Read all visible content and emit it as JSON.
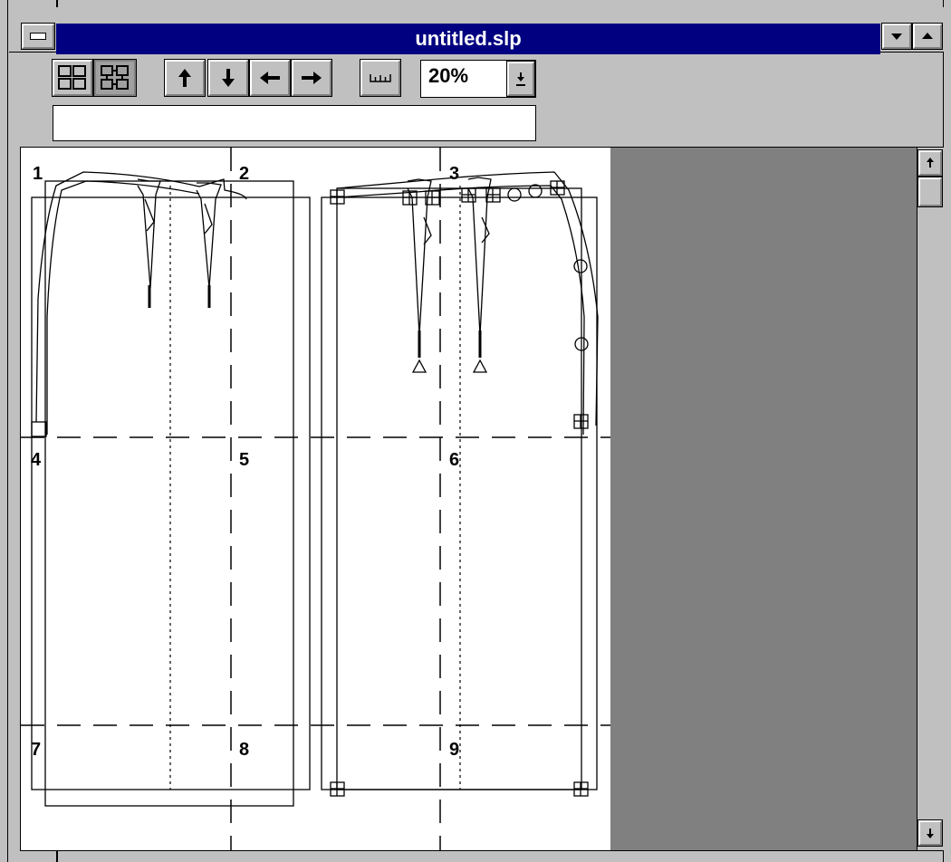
{
  "window": {
    "title": "untitled.slp"
  },
  "toolbar": {
    "zoom_value": "20%",
    "status_text": ""
  },
  "icons": {
    "system_menu": "system-menu-icon",
    "minimize": "minimize-arrow-icon",
    "maximize": "maximize-arrow-icon",
    "tile_view": "tile-grid-icon",
    "connected_tile_view": "connected-tile-grid-icon",
    "move_up": "arrow-up-icon",
    "move_down": "arrow-down-icon",
    "move_left": "arrow-left-icon",
    "move_right": "arrow-right-icon",
    "ruler": "ruler-icon",
    "zoom_dropdown": "dropdown-arrow-icon",
    "scroll_up": "scroll-up-icon",
    "scroll_down": "scroll-down-icon"
  },
  "canvas": {
    "page_labels": [
      "1",
      "2",
      "3",
      "4",
      "5",
      "6",
      "7",
      "8",
      "9"
    ],
    "background": "#ffffff",
    "off_page_color": "#808080"
  },
  "colors": {
    "titlebar": "#000080",
    "face": "#c0c0c0"
  }
}
